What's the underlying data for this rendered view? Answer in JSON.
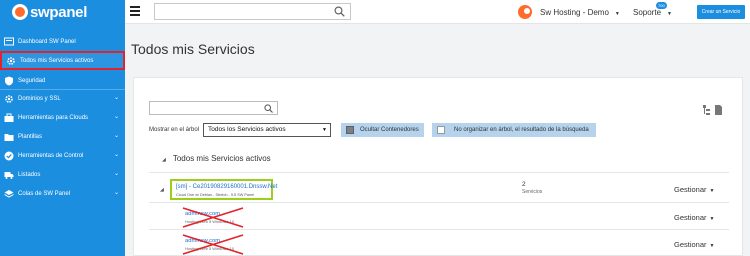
{
  "brand": {
    "name": "swpanel",
    "accent": "#1c8ee0",
    "logo_color": "#ff6a2d"
  },
  "sidebar": {
    "items": [
      {
        "label": "Dashboard SW Panel",
        "icon": "dashboard-icon",
        "has_chevron": false
      },
      {
        "label": "Todos mis Servicios activos",
        "icon": "gear-icon",
        "has_chevron": false,
        "active": true
      },
      {
        "label": "Seguridad",
        "icon": "shield-icon",
        "has_chevron": false
      },
      {
        "label": "Dominios y SSL",
        "icon": "gear-icon",
        "has_chevron": true
      },
      {
        "label": "Herramientas para Clouds",
        "icon": "briefcase-icon",
        "has_chevron": true
      },
      {
        "label": "Plantillas",
        "icon": "folder-icon",
        "has_chevron": true
      },
      {
        "label": "Herramientas de Control",
        "icon": "check-circle-icon",
        "has_chevron": true
      },
      {
        "label": "Listados",
        "icon": "truck-icon",
        "has_chevron": true
      },
      {
        "label": "Colas de SW Panel",
        "icon": "layers-icon",
        "has_chevron": true
      }
    ]
  },
  "topbar": {
    "search_placeholder": "",
    "account": "Sw Hosting - Demo",
    "support": "Soporte",
    "support_badge": "700",
    "create_button": "Crear un Servicio"
  },
  "page": {
    "title": "Todos mis Servicios",
    "show_in_tree_label": "Mostrar en el árbol",
    "show_in_tree_value": "Todos los Servicios activos",
    "hide_containers_label": "Ocultar Contenedores",
    "no_tree_label": "No organizar en árbol, el resultado de la búsqueda",
    "section_title": "Todos mis Servicios activos"
  },
  "services": [
    {
      "name": "[sm] - Ce20190829160001.Dnssw.Net",
      "subtitle": "Cloud One w/ Debian - Stretch - 9.5 SW Panel",
      "count": "2",
      "count_label": "Servicios",
      "manage_label": "Gestionar"
    }
  ],
  "children": [
    {
      "name": "adminsw.com",
      "desc": "Hosting Web 5 Windows 10",
      "manage_label": "Gestionar"
    },
    {
      "name": "adminsw.com",
      "desc": "Hosting Web 5 Windows 10",
      "manage_label": "Gestionar"
    }
  ]
}
